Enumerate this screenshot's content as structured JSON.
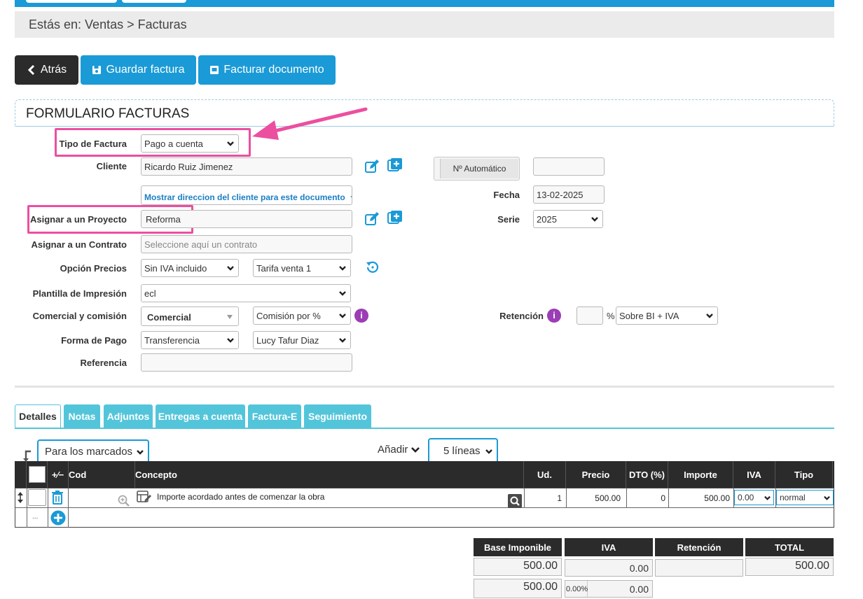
{
  "breadcrumb": "Estás en: Ventas > Facturas",
  "buttons": {
    "back": "Atrás",
    "save": "Guardar factura",
    "invoice": "Facturar documento"
  },
  "form": {
    "title": "FORMULARIO FACTURAS",
    "tipo_factura": {
      "label": "Tipo de Factura",
      "value": "Pago a cuenta"
    },
    "cliente": {
      "label": "Cliente",
      "value": "Ricardo Ruiz Jimenez"
    },
    "mostrar_direccion": "Mostrar direccion del cliente para este documento",
    "proyecto": {
      "label": "Asignar a un Proyecto",
      "value": "Reforma"
    },
    "contrato": {
      "label": "Asignar a un Contrato",
      "placeholder": "Seleccione aquí un contrato"
    },
    "opcion_precios": {
      "label": "Opción Precios",
      "value": "Sin IVA incluido",
      "tarifa": "Tarifa venta 1"
    },
    "plantilla": {
      "label": "Plantilla de Impresión",
      "value": "ecl"
    },
    "comercial": {
      "label": "Comercial y comisión",
      "value": "Comercial",
      "comision": "Comisión por %"
    },
    "forma_pago": {
      "label": "Forma de Pago",
      "value": "Transferencia",
      "persona": "Lucy Tafur Diaz"
    },
    "referencia": {
      "label": "Referencia",
      "value": ""
    },
    "numero": {
      "label": "Nº Automático",
      "value": ""
    },
    "fecha": {
      "label": "Fecha",
      "value": "13-02-2025"
    },
    "serie": {
      "label": "Serie",
      "value": "2025"
    },
    "retencion": {
      "label": "Retención",
      "value": "",
      "percent_sign": "%",
      "mode": "Sobre BI + IVA"
    }
  },
  "tabs": [
    "Detalles",
    "Notas",
    "Adjuntos",
    "Entregas a cuenta",
    "Factura-E",
    "Seguimiento"
  ],
  "toolbar": {
    "bulk_action": "Para los marcados",
    "add_label": "Añadir",
    "lines": "5 líneas"
  },
  "table": {
    "columns": [
      "+⁄−",
      "Cod",
      "Concepto",
      "Ud.",
      "Precio",
      "DTO (%)",
      "Importe",
      "IVA",
      "Tipo"
    ],
    "rows": [
      {
        "cod": "",
        "concepto": "Importe acordado antes de comenzar la obra",
        "ud": "1",
        "precio": "500.00",
        "dto": "0",
        "importe": "500.00",
        "iva": "0.00",
        "tipo": "normal"
      }
    ],
    "more": "..."
  },
  "totals": {
    "headers": [
      "Base Imponible",
      "IVA",
      "Retención",
      "TOTAL"
    ],
    "row1": {
      "base": "500.00",
      "iva": "0.00",
      "retencion": "",
      "total": "500.00"
    },
    "row2": {
      "base": "500.00",
      "iva_pct": "0.00%",
      "iva": "0.00"
    }
  },
  "colors": {
    "accent": "#1a9ad6",
    "tab": "#53c5da",
    "highlight": "#ec4fa0",
    "info": "#9b3db5"
  }
}
